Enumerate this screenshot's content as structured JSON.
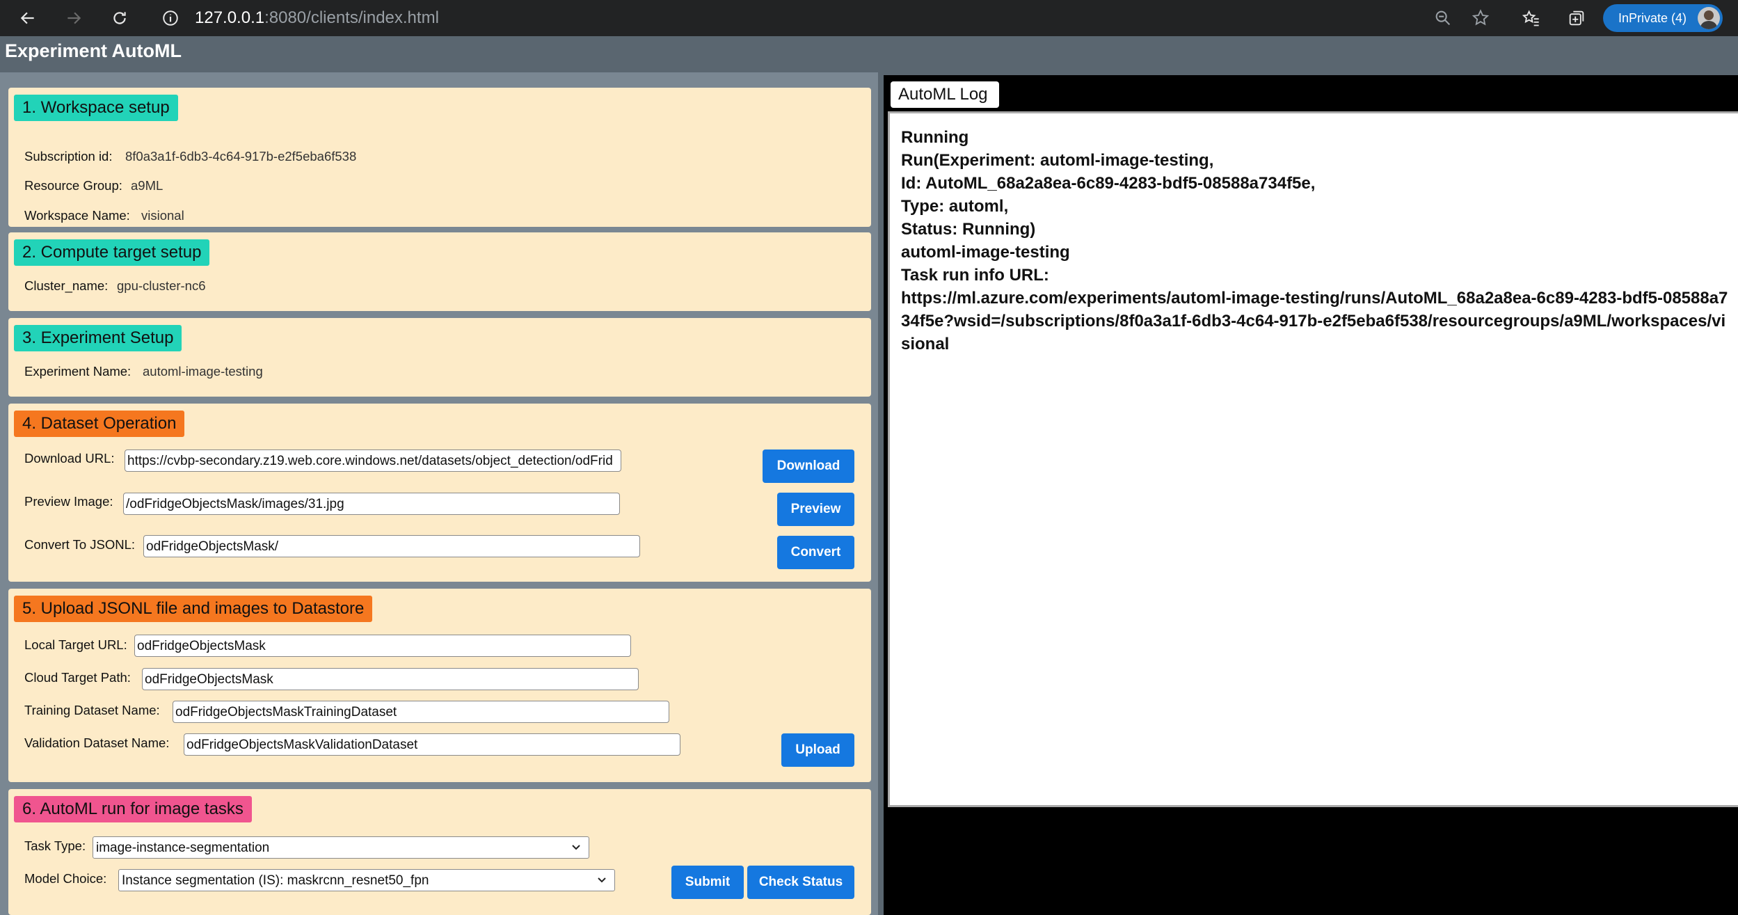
{
  "browser": {
    "url_host": "127.0.0.1",
    "url_rest": ":8080/clients/index.html",
    "inprivate_label": "InPrivate (4)"
  },
  "page": {
    "title": "Experiment AutoML"
  },
  "workspace": {
    "header": "1. Workspace setup",
    "subscription_label": "Subscription id:",
    "subscription_value": "8f0a3a1f-6db3-4c64-917b-e2f5eba6f538",
    "resource_group_label": "Resource Group:",
    "resource_group_value": "a9ML",
    "workspace_name_label": "Workspace Name:",
    "workspace_name_value": "visional"
  },
  "compute": {
    "header": "2. Compute target setup",
    "cluster_label": "Cluster_name:",
    "cluster_value": "gpu-cluster-nc6"
  },
  "experiment": {
    "header": "3. Experiment Setup",
    "name_label": "Experiment Name:",
    "name_value": "automl-image-testing"
  },
  "dataset": {
    "header": "4. Dataset Operation",
    "download_label": "Download URL:",
    "download_value": "https://cvbp-secondary.z19.web.core.windows.net/datasets/object_detection/odFrid",
    "download_button": "Download",
    "preview_label": "Preview Image:",
    "preview_value": "/odFridgeObjectsMask/images/31.jpg",
    "preview_button": "Preview",
    "convert_label": "Convert To JSONL:",
    "convert_value": "odFridgeObjectsMask/",
    "convert_button": "Convert"
  },
  "upload": {
    "header": "5. Upload JSONL file and images to Datastore",
    "local_label": "Local Target URL:",
    "local_value": "odFridgeObjectsMask",
    "cloud_label": "Cloud Target Path:",
    "cloud_value": "odFridgeObjectsMask",
    "training_label": "Training Dataset Name:",
    "training_value": "odFridgeObjectsMaskTrainingDataset",
    "validation_label": "Validation Dataset Name:",
    "validation_value": "odFridgeObjectsMaskValidationDataset",
    "upload_button": "Upload"
  },
  "automl": {
    "header": "6. AutoML run for image tasks",
    "task_label": "Task Type:",
    "task_value": "image-instance-segmentation",
    "model_label": "Model Choice:",
    "model_value": "Instance segmentation (IS): maskrcnn_resnet50_fpn",
    "submit_button": "Submit",
    "check_button": "Check Status"
  },
  "log": {
    "tab": "AutoML Log",
    "text": "Running\nRun(Experiment: automl-image-testing,\nId: AutoML_68a2a8ea-6c89-4283-bdf5-08588a734f5e,\nType: automl,\nStatus: Running)\nautoml-image-testing\nTask run info URL:\nhttps://ml.azure.com/experiments/automl-image-testing/runs/AutoML_68a2a8ea-6c89-4283-bdf5-08588a734f5e?wsid=/subscriptions/8f0a3a1f-6db3-4c64-917b-e2f5eba6f538/resourcegroups/a9ML/workspaces/visional"
  }
}
